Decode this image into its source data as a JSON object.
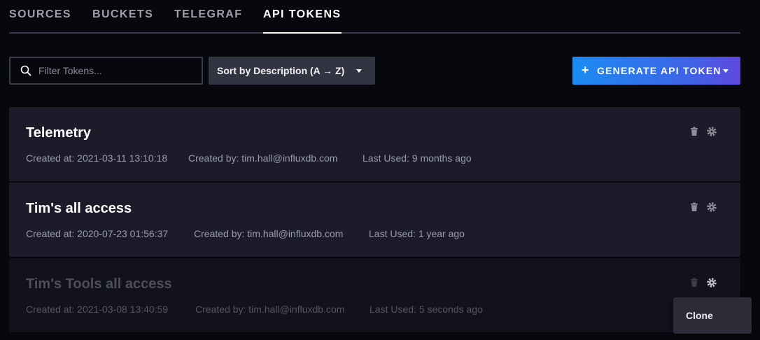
{
  "tabs": [
    {
      "label": "SOURCES",
      "active": false
    },
    {
      "label": "BUCKETS",
      "active": false
    },
    {
      "label": "TELEGRAF",
      "active": false
    },
    {
      "label": "API TOKENS",
      "active": true
    }
  ],
  "filter": {
    "placeholder": "Filter Tokens...",
    "value": ""
  },
  "sort": {
    "label": "Sort by Description (A → Z)"
  },
  "generate": {
    "label": "GENERATE API TOKEN"
  },
  "tokens": [
    {
      "name": "Telemetry",
      "created_at": "Created at: 2021-03-11 13:10:18",
      "created_by": "Created by: tim.hall@influxdb.com",
      "last_used": "Last Used: 9 months ago",
      "dimmed": false
    },
    {
      "name": "Tim's all access",
      "created_at": "Created at: 2020-07-23 01:56:37",
      "created_by": "Created by: tim.hall@influxdb.com",
      "last_used": "Last Used: 1 year ago",
      "dimmed": false
    },
    {
      "name": "Tim's Tools all access",
      "created_at": "Created at: 2021-03-08 13:40:59",
      "created_by": "Created by: tim.hall@influxdb.com",
      "last_used": "Last Used: 5 seconds ago",
      "dimmed": true
    }
  ],
  "popover": {
    "clone_label": "Clone"
  },
  "icons": {
    "search": "search-icon",
    "sort_caret": "chevron-down-icon",
    "generate_plus": "plus-icon",
    "trash": "trash-icon",
    "gear": "gear-icon"
  },
  "colors": {
    "background": "#07070e",
    "card": "#1b1b2a",
    "accent_start": "#1a8cf2",
    "accent_end": "#5f48df"
  }
}
